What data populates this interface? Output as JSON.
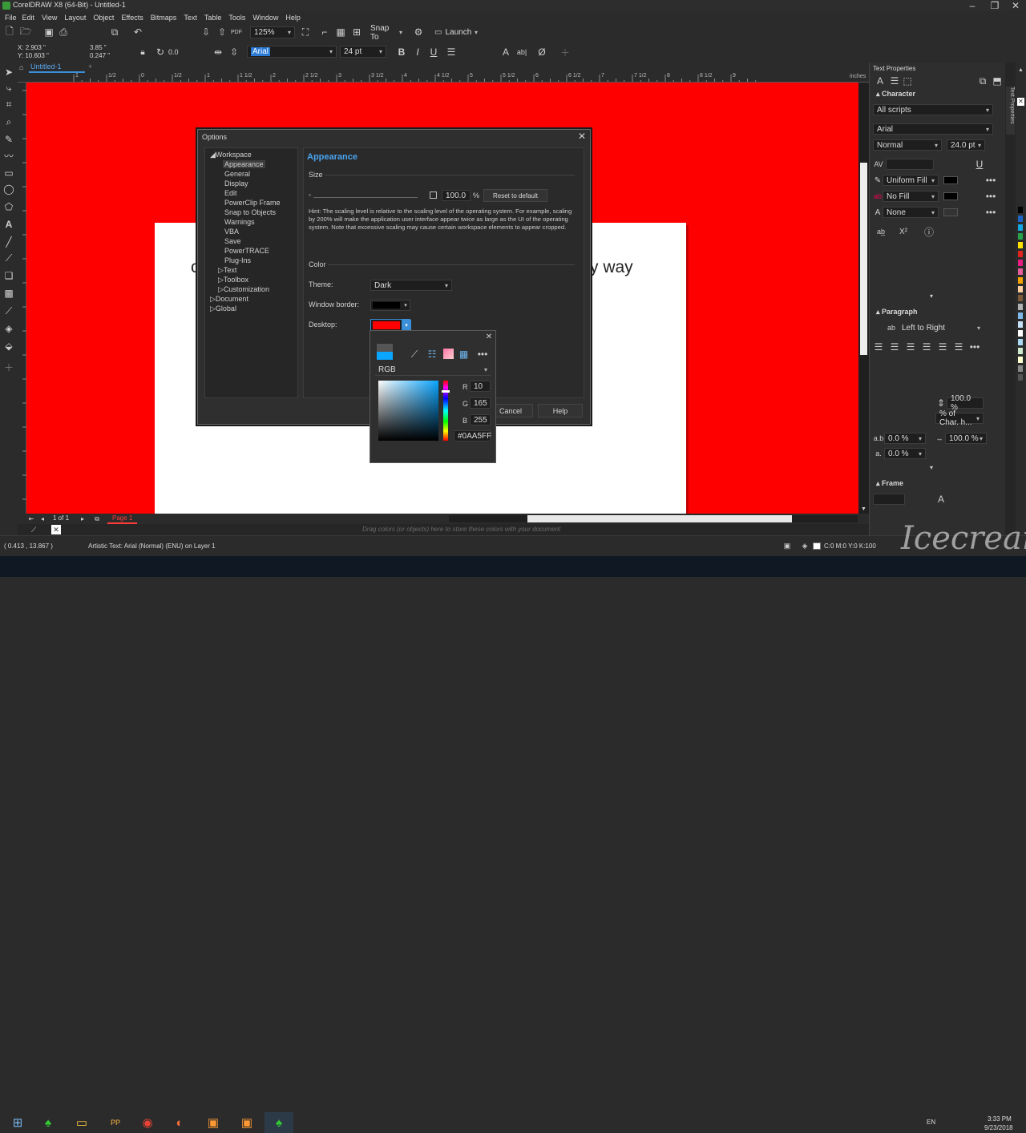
{
  "title_bar": {
    "title": "CorelDRAW X8 (64-Bit) - Untitled-1"
  },
  "menu": [
    "File",
    "Edit",
    "View",
    "Layout",
    "Object",
    "Effects",
    "Bitmaps",
    "Text",
    "Table",
    "Tools",
    "Window",
    "Help"
  ],
  "standard_toolbar": {
    "zoom": "125%",
    "snap_to": "Snap To",
    "launch": "Launch"
  },
  "property_bar": {
    "x": "X: 2.903 \"",
    "y": "Y: 10.603 \"",
    "w": "3.85 \"",
    "h": "0.247 \"",
    "angle": "0.0",
    "font": "Arial",
    "size": "24 pt",
    "bold": "B",
    "italic": "I",
    "underline": "U"
  },
  "doc_tab": "Untitled-1",
  "ruler": {
    "unit": "inches",
    "labels": [
      "1",
      "1/2",
      "0",
      "1/2",
      "1",
      "1 1/2",
      "2",
      "2 1/2",
      "3",
      "3 1/2",
      "4",
      "4 1/2",
      "5",
      "5 1/2",
      "6",
      "6 1/2",
      "7",
      "7 1/2",
      "8",
      "8 1/2",
      "9"
    ]
  },
  "canvas": {
    "text_left": "c",
    "text_right": "y way",
    "desktop_color": "#ff0000"
  },
  "options_dialog": {
    "title": "Options",
    "tree": [
      "Workspace",
      "Appearance",
      "General",
      "Display",
      "Edit",
      "PowerClip Frame",
      "Snap to Objects",
      "Warnings",
      "VBA",
      "Save",
      "PowerTRACE",
      "Plug-Ins",
      "Text",
      "Toolbox",
      "Customization",
      "Document",
      "Global"
    ],
    "heading": "Appearance",
    "size_label": "Size",
    "scale_value": "100.0",
    "percent": "%",
    "reset": "Reset to default",
    "hint": "Hint: The scaling level is relative to the scaling level of the operating system. For example, scaling by 200% will make the application user interface appear twice as large as the UI of the operating system. Note that excessive scaling may cause certain workspace elements to appear cropped.",
    "color_label": "Color",
    "theme_label": "Theme:",
    "theme_value": "Dark",
    "border_label": "Window border:",
    "desktop_label": "Desktop:",
    "cancel": "Cancel",
    "help": "Help"
  },
  "color_picker": {
    "model": "RGB",
    "r_label": "R",
    "r": "10",
    "g_label": "G",
    "g": "165",
    "b_label": "B",
    "b": "255",
    "hex": "#0AA5FF"
  },
  "docker": {
    "title": "Text Properties",
    "character": "Character",
    "scripts": "All scripts",
    "font": "Arial",
    "style": "Normal",
    "size": "24.0 pt",
    "fill": "Uniform Fill",
    "bg_fill": "No Fill",
    "outline": "None",
    "paragraph": "Paragraph",
    "direction": "Left to Right",
    "line_spacing": "100.0 %",
    "spacing_unit": "% of Char. h...",
    "char_spacing": "0.0 %",
    "word_spacing": "100.0 %",
    "lang_spacing": "0.0 %",
    "frame": "Frame"
  },
  "page_nav": {
    "count": "1 of 1",
    "page": "Page 1",
    "drag_hint": "Drag colors (or objects) here to store these colors with your document"
  },
  "status": {
    "coords": "( 0.413 , 13.867 )",
    "info": "Artistic Text: Arial (Normal) (ENU) on Layer 1",
    "fill_values": "C:0 M:0 Y:0 K:100"
  },
  "taskbar": {
    "lang": "EN",
    "time": "3:33 PM",
    "date": "9/23/2018"
  },
  "watermark": "Icecream"
}
